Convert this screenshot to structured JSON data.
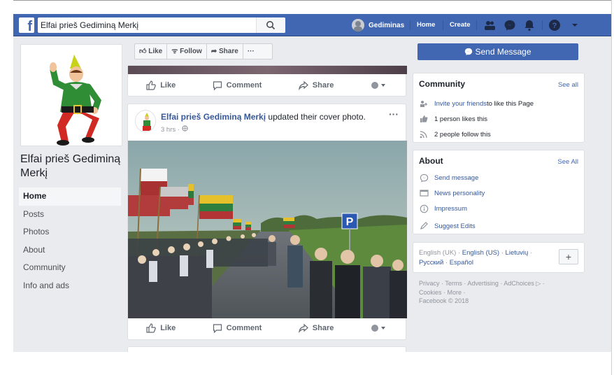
{
  "header": {
    "search_value": "Elfai prieš Gediminą Merkį",
    "user_name": "Gediminas",
    "home": "Home",
    "create": "Create"
  },
  "page": {
    "name": "Elfai prieš Gediminą Merkį"
  },
  "leftnav": {
    "items": [
      "Home",
      "Posts",
      "Photos",
      "About",
      "Community",
      "Info and ads"
    ]
  },
  "actions": {
    "like": "Like",
    "follow": "Follow",
    "share": "Share",
    "more": "···"
  },
  "post_actions": {
    "like": "Like",
    "comment": "Comment",
    "share": "Share"
  },
  "post": {
    "author": "Elfai prieš Gediminą Merkį",
    "action": " updated their cover photo.",
    "time": "3 hrs · ",
    "more": "···"
  },
  "send_message": "Send Message",
  "community": {
    "title": "Community",
    "see_all": "See all",
    "invite_link": "Invite your friends",
    "invite_rest": " to like this Page",
    "likes": "1 person likes this",
    "follows": "2 people follow this"
  },
  "about": {
    "title": "About",
    "see_all": "See All",
    "items": [
      "Send message",
      "News personality",
      "Impressum",
      "Suggest Edits"
    ]
  },
  "languages": {
    "current": "English (UK) · ",
    "others": [
      "English (US)",
      "Lietuvių",
      "Русский",
      "Español"
    ],
    "plus": "+"
  },
  "footer": {
    "line1": "Privacy · Terms · Advertising · AdChoices ▷ ·",
    "line2": "Cookies · More ·",
    "line3": "Facebook © 2018"
  },
  "colors": {
    "brand": "#4267b2",
    "link": "#365899",
    "background": "#e9ebee"
  }
}
